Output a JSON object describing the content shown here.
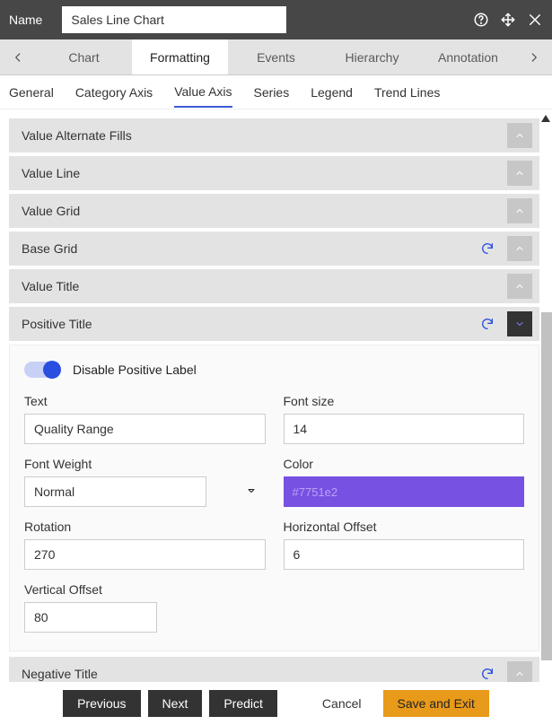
{
  "header": {
    "name_label": "Name",
    "name_value": "Sales Line Chart"
  },
  "toptabs": {
    "items": [
      "Chart",
      "Formatting",
      "Events",
      "Hierarchy",
      "Annotation"
    ],
    "active": 1
  },
  "subtabs": {
    "items": [
      "General",
      "Category Axis",
      "Value Axis",
      "Series",
      "Legend",
      "Trend Lines"
    ],
    "active": 2
  },
  "sections": {
    "s0": {
      "title": "Value Alternate Fills",
      "refresh": false,
      "expanded": false
    },
    "s1": {
      "title": "Value Line",
      "refresh": false,
      "expanded": false
    },
    "s2": {
      "title": "Value Grid",
      "refresh": false,
      "expanded": false
    },
    "s3": {
      "title": "Base Grid",
      "refresh": true,
      "expanded": false
    },
    "s4": {
      "title": "Value Title",
      "refresh": false,
      "expanded": false
    },
    "s5": {
      "title": "Positive Title",
      "refresh": true,
      "expanded": true
    },
    "s6": {
      "title": "Negative Title",
      "refresh": true,
      "expanded": false
    }
  },
  "positive_title_form": {
    "toggle_label": "Disable Positive Label",
    "toggle_on": true,
    "fields": {
      "text_label": "Text",
      "text_value": "Quality Range",
      "font_size_label": "Font size",
      "font_size_value": "14",
      "font_weight_label": "Font Weight",
      "font_weight_value": "Normal",
      "color_label": "Color",
      "color_value": "#7751e2",
      "rotation_label": "Rotation",
      "rotation_value": "270",
      "horizontal_offset_label": "Horizontal Offset",
      "horizontal_offset_value": "6",
      "vertical_offset_label": "Vertical Offset",
      "vertical_offset_value": "80"
    }
  },
  "footer": {
    "previous": "Previous",
    "next": "Next",
    "predict": "Predict",
    "cancel": "Cancel",
    "save_exit": "Save and Exit"
  }
}
